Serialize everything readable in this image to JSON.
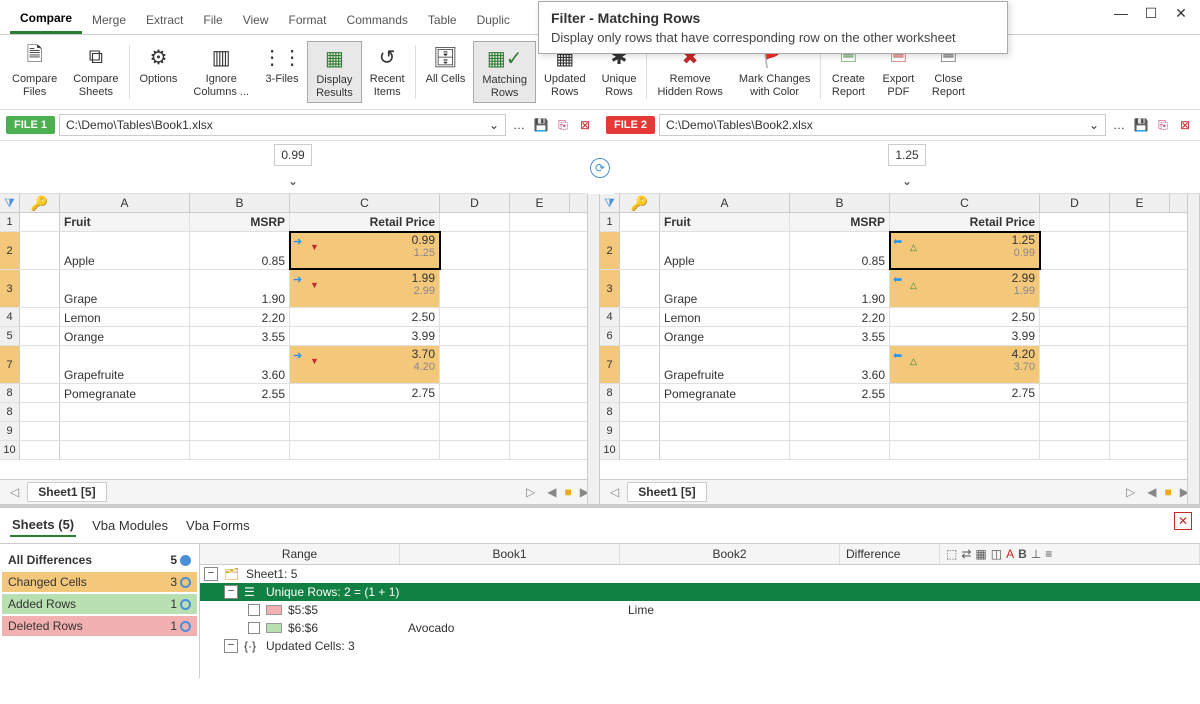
{
  "tooltip": {
    "title": "Filter - Matching Rows",
    "desc": "Display only rows that have corresponding row on the other worksheet"
  },
  "tabs": [
    "Compare",
    "Merge",
    "Extract",
    "File",
    "View",
    "Format",
    "Commands",
    "Table",
    "Duplic"
  ],
  "ribbon": {
    "compare_files": "Compare\nFiles",
    "compare_sheets": "Compare\nSheets",
    "options": "Options",
    "ignore_columns": "Ignore\nColumns ...",
    "three_files": "3-Files",
    "display_results": "Display\nResults",
    "recent_items": "Recent\nItems",
    "all_cells": "All Cells",
    "matching_rows": "Matching\nRows",
    "updated_rows": "Updated\nRows",
    "unique_rows": "Unique\nRows",
    "remove_hidden": "Remove\nHidden Rows",
    "mark_changes": "Mark Changes\nwith Color",
    "create_report": "Create\nReport",
    "export_pdf": "Export\nPDF",
    "close_report": "Close\nReport"
  },
  "file1": {
    "badge": "FILE 1",
    "path": "C:\\Demo\\Tables\\Book1.xlsx",
    "value": "0.99"
  },
  "file2": {
    "badge": "FILE 2",
    "path": "C:\\Demo\\Tables\\Book2.xlsx",
    "value": "1.25"
  },
  "columns": [
    "A",
    "B",
    "C",
    "D",
    "E"
  ],
  "headers": {
    "fruit": "Fruit",
    "msrp": "MSRP",
    "retail": "Retail Price"
  },
  "left_rows": [
    {
      "n": "1",
      "type": "header"
    },
    {
      "n": "2",
      "fruit": "Apple",
      "msrp": "0.85",
      "cmain": "0.99",
      "csub": "1.25",
      "changed": true,
      "selected": true,
      "dir": "down"
    },
    {
      "n": "3",
      "fruit": "Grape",
      "msrp": "1.90",
      "cmain": "1.99",
      "csub": "2.99",
      "changed": true,
      "dir": "down"
    },
    {
      "n": "4",
      "fruit": "Lemon",
      "msrp": "2.20",
      "cmain": "2.50"
    },
    {
      "n": "5",
      "fruit": "Orange",
      "msrp": "3.55",
      "cmain": "3.99"
    },
    {
      "n": "7",
      "fruit": "Grapefruite",
      "msrp": "3.60",
      "cmain": "3.70",
      "csub": "4.20",
      "changed": true,
      "dir": "down"
    },
    {
      "n": "8",
      "fruit": "Pomegranate",
      "msrp": "2.55",
      "cmain": "2.75"
    },
    {
      "n": "8"
    },
    {
      "n": "9"
    },
    {
      "n": "10"
    }
  ],
  "right_rows": [
    {
      "n": "1",
      "type": "header"
    },
    {
      "n": "2",
      "fruit": "Apple",
      "msrp": "0.85",
      "cmain": "1.25",
      "csub": "0.99",
      "changed": true,
      "selected": true,
      "dir": "up"
    },
    {
      "n": "3",
      "fruit": "Grape",
      "msrp": "1.90",
      "cmain": "2.99",
      "csub": "1.99",
      "changed": true,
      "dir": "up"
    },
    {
      "n": "4",
      "fruit": "Lemon",
      "msrp": "2.20",
      "cmain": "2.50"
    },
    {
      "n": "6",
      "fruit": "Orange",
      "msrp": "3.55",
      "cmain": "3.99"
    },
    {
      "n": "7",
      "fruit": "Grapefruite",
      "msrp": "3.60",
      "cmain": "4.20",
      "csub": "3.70",
      "changed": true,
      "dir": "up"
    },
    {
      "n": "8",
      "fruit": "Pomegranate",
      "msrp": "2.55",
      "cmain": "2.75"
    },
    {
      "n": "8"
    },
    {
      "n": "9"
    },
    {
      "n": "10"
    }
  ],
  "sheet_tab": "Sheet1 [5]",
  "bottom": {
    "tabs": {
      "sheets": "Sheets (5)",
      "vba_mod": "Vba Modules",
      "vba_forms": "Vba Forms"
    },
    "legend": {
      "all": "All Differences",
      "all_count": "5",
      "changed": "Changed Cells",
      "changed_count": "3",
      "added": "Added Rows",
      "added_count": "1",
      "deleted": "Deleted Rows",
      "deleted_count": "1"
    },
    "cols": {
      "range": "Range",
      "book1": "Book1",
      "book2": "Book2",
      "diff": "Difference"
    },
    "list": {
      "sheet": "Sheet1: 5",
      "unique": "Unique Rows: 2 = (1 + 1)",
      "r1_range": "$5:$5",
      "r1_b2": "Lime",
      "r2_range": "$6:$6",
      "r2_b1": "Avocado",
      "updated": "Updated Cells: 3"
    }
  }
}
